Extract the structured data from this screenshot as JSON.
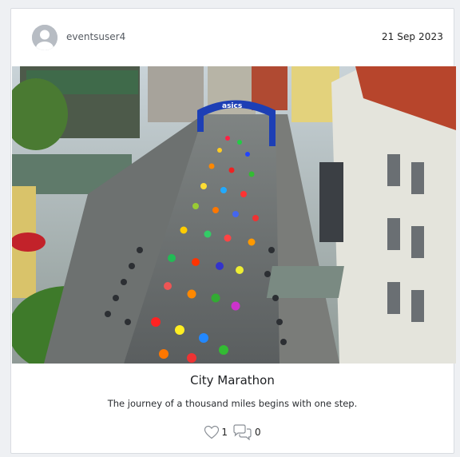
{
  "post": {
    "username": "eventsuser4",
    "date": "21 Sep 2023",
    "title": "City Marathon",
    "description": "The journey of a thousand miles begins with one step.",
    "likes": "1",
    "comments": "0",
    "image_banner_text": "asics"
  },
  "icons": {
    "avatar": "user-avatar-icon",
    "like": "heart-icon",
    "comment": "comment-bubbles-icon"
  },
  "colors": {
    "banner_blue": "#1d3fb5",
    "card_border": "#d9dce1",
    "avatar_grey": "#b7bcc3"
  }
}
